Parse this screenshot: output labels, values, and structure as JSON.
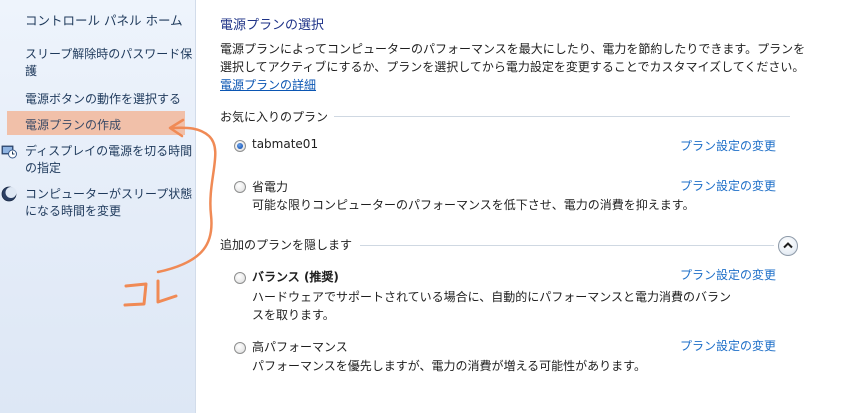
{
  "left_pane": {
    "home_link": "コントロール パネル ホーム",
    "items": [
      {
        "label": "スリープ解除時のパスワード保護"
      },
      {
        "label": "電源ボタンの動作を選択する"
      },
      {
        "label": "電源プランの作成"
      },
      {
        "label": "ディスプレイの電源を切る時間の指定"
      },
      {
        "label": "コンピューターがスリープ状態になる時間を変更"
      }
    ]
  },
  "main": {
    "title": "電源プランの選択",
    "description": "電源プランによってコンピューターのパフォーマンスを最大にしたり、電力を節約したりできます。プランを選択してアクティブにするか、プランを選択してから電力設定を変更することでカスタマイズしてください。",
    "details_link": "電源プランの詳細",
    "favorites": {
      "label": "お気に入りのプラン",
      "plans": [
        {
          "name": "tabmate01",
          "checked": true,
          "link": "プラン設定の変更",
          "description": ""
        },
        {
          "name": "省電力",
          "checked": false,
          "link": "プラン設定の変更",
          "description": "可能な限りコンピューターのパフォーマンスを低下させ、電力の消費を抑えます。"
        }
      ]
    },
    "additional": {
      "label": "追加のプランを隠します",
      "plans": [
        {
          "name": "バランス (推奨)",
          "checked": false,
          "link": "プラン設定の変更",
          "description": "ハードウェアでサポートされている場合に、自動的にパフォーマンスと電力消費のバランスを取ります。"
        },
        {
          "name": "高パフォーマンス",
          "checked": false,
          "link": "プラン設定の変更",
          "description": "パフォーマンスを優先しますが、電力の消費が増える可能性があります。"
        }
      ]
    }
  },
  "annotation": {
    "text": "コレ",
    "color": "#f08a55"
  },
  "colors": {
    "accent_link": "#1e6fc8",
    "title": "#1e3287",
    "highlight": "#f1c0a9"
  }
}
